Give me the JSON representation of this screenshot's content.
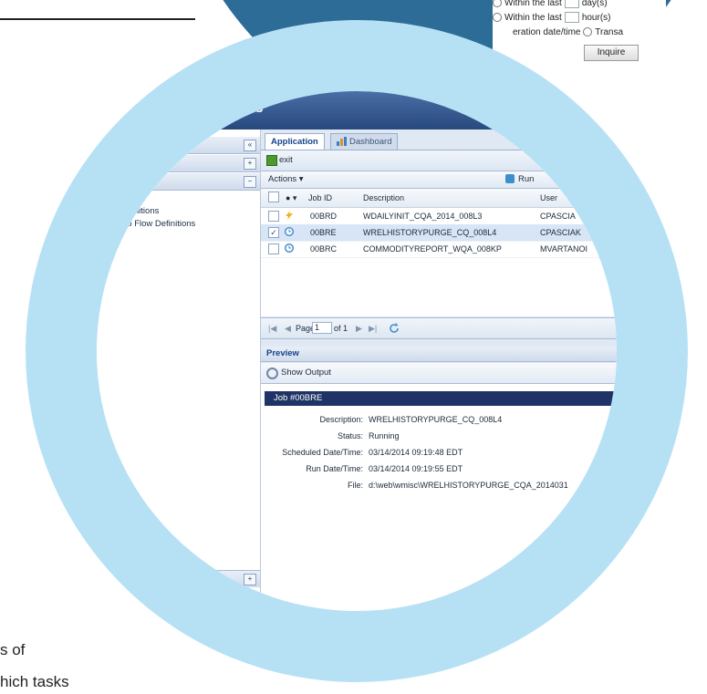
{
  "filter": {
    "row1": "Within the last",
    "row1_unit": "day(s)",
    "row2": "Within the last",
    "row2_unit": "hour(s)",
    "row3_a": "eration date/time",
    "row3_b": "Transa",
    "inquire": "Inquire"
  },
  "app": {
    "title": "s",
    "left": {
      "collapse_glyph": "«",
      "plus_glyph": "+",
      "minus_glyph": "−",
      "tree": [
        "Definitions",
        "ob Flow Definitions"
      ]
    },
    "tabs": [
      {
        "label": "Application"
      },
      {
        "label": "Dashboard"
      }
    ],
    "toolbar": {
      "exit": "exit"
    },
    "actions": {
      "label": "Actions ▾",
      "run": "Run"
    },
    "grid": {
      "headers": {
        "job_id": "Job ID",
        "description": "Description",
        "user": "User"
      },
      "rows": [
        {
          "checked": false,
          "status": "lightning-icon",
          "job_id": "00BRD",
          "description": "WDAILYINIT_CQA_2014_008L3",
          "user": "CPASCIA"
        },
        {
          "checked": true,
          "status": "clock-icon",
          "job_id": "00BRE",
          "description": "WRELHISTORYPURGE_CQ_008L4",
          "user": "CPASCIAK"
        },
        {
          "checked": false,
          "status": "clock-icon",
          "job_id": "00BRC",
          "description": "COMMODITYREPORT_WQA_008KP",
          "user": "MVARTANOI"
        }
      ]
    },
    "pager": {
      "page_label": "Page",
      "page_value": "1",
      "of_label": "of 1"
    },
    "preview": {
      "title": "Preview",
      "show_output": "Show Output",
      "job_title": "Job #00BRE",
      "fields": [
        {
          "label": "Description:",
          "value": "WRELHISTORYPURGE_CQ_008L4"
        },
        {
          "label": "Status:",
          "value": "Running"
        },
        {
          "label": "Scheduled Date/Time:",
          "value": "03/14/2014 09:19:48 EDT"
        },
        {
          "label": "Run Date/Time:",
          "value": "03/14/2014 09:19:55 EDT"
        },
        {
          "label": "File:",
          "value": "d:\\web\\wmisc\\WRELHISTORYPURGE_CQA_2014031"
        }
      ]
    }
  },
  "page_text": {
    "line1": "s of",
    "line2": "hich tasks"
  },
  "colors": {
    "ring": "#b6e1f5",
    "arc": "#2e6c98",
    "job_header": "#1f3366"
  }
}
